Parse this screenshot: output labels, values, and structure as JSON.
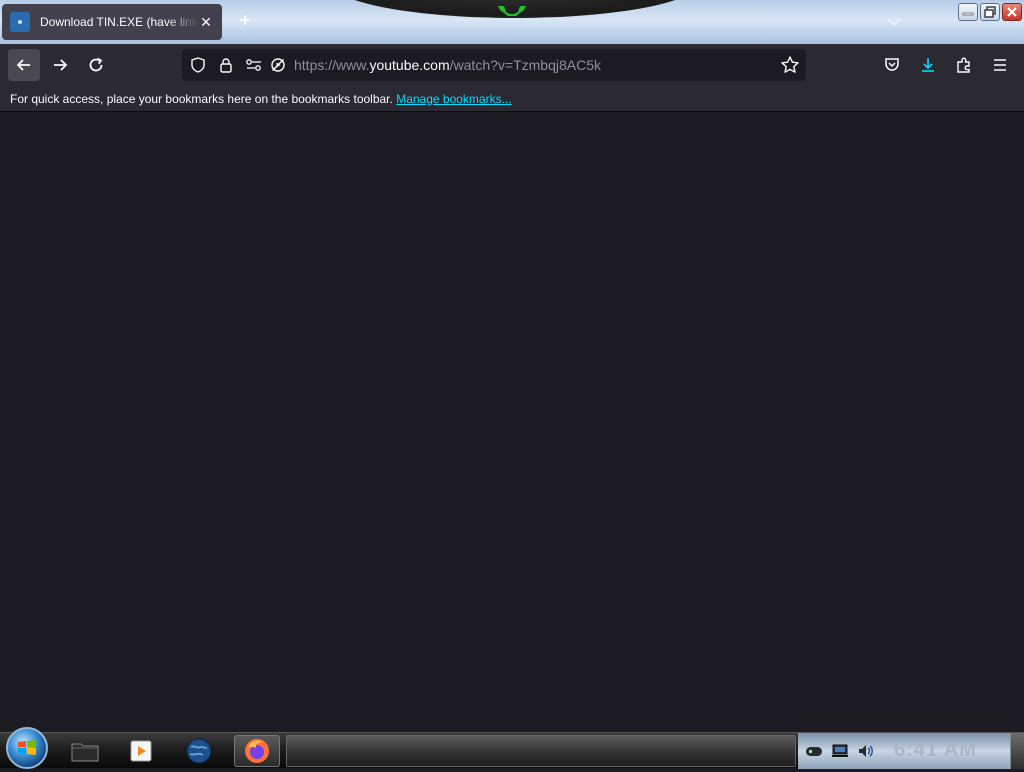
{
  "tab": {
    "title": "Download TIN.EXE (have link in description)",
    "close": "✕"
  },
  "new_tab": "+",
  "url": {
    "scheme_www": "https://www.",
    "host": "youtube.com",
    "path": "/watch?v=Tzmbqj8AC5k"
  },
  "bookmarks_bar": {
    "message": "For quick access, place your bookmarks here on the bookmarks toolbar.",
    "manage_link": "Manage bookmarks..."
  },
  "taskbar": {
    "clock": "6:41 AM"
  },
  "colors": {
    "accent": "#00ddff",
    "toolbar": "#2b2a33",
    "content_bg": "#1c1b22"
  }
}
